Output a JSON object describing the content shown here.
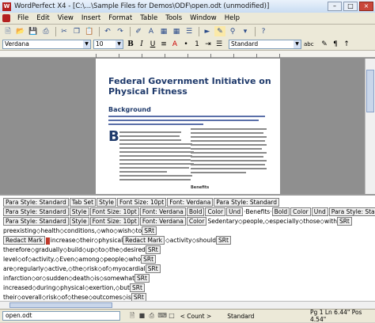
{
  "window": {
    "title": "WordPerfect X4 - [C:\\...\\Sample Files for Demos\\ODF\\open.odt (unmodified)]"
  },
  "menu": [
    "File",
    "Edit",
    "View",
    "Insert",
    "Format",
    "Table",
    "Tools",
    "Window",
    "Help"
  ],
  "format_bar": {
    "font": "Verdana",
    "size": "10",
    "style": "Standard"
  },
  "document": {
    "title": "Federal Government Initiative on Physical Fitness",
    "heading": "Background",
    "dropcap": "B",
    "subhead": "Benefits"
  },
  "reveal_codes": [
    [
      "Para Style: Standard",
      "Tab Set",
      "Style",
      "Font Size: 10pt",
      "Font: Verdana",
      "Para Style: Standard"
    ],
    [
      "Para Style: Standard",
      "Style",
      "Font Size: 10pt",
      "Font: Verdana",
      "Bold",
      "Color",
      "Und",
      "·Benefits·",
      "Bold",
      "Color",
      "Und",
      "Para Style: Standard"
    ],
    [
      "Para Style: Standard",
      "Style",
      "Font Size: 10pt",
      "Font: Verdana",
      "Color",
      "Sedentary◇people,◇especially◇those◇with",
      "SRt"
    ],
    [
      "preexisting◇health◇conditions,◇who◇wish◇to",
      "SRt"
    ],
    [
      "Redact Mark",
      "increase◇their◇physical",
      "Redact Mark",
      "◇activity◇should",
      "SRt"
    ],
    [
      "therefore◇gradually◇build◇up◇to◇the◇desired",
      "SRt"
    ],
    [
      "level◇of◇activity.◇Even◇among◇people◇who",
      "SRt"
    ],
    [
      "are◇regularly◇active,◇the◇risk◇of◇myocardial",
      "SRt"
    ],
    [
      "infarction◇or◇sudden◇death◇is◇somewhat",
      "SRt"
    ],
    [
      "increased◇during◇physical◇exertion,◇but",
      "SRt"
    ],
    [
      "their◇overall◇risk◇of◇these◇outcomes◇is",
      "SRt"
    ]
  ],
  "status": {
    "doc_tab": "open.odt",
    "count": "< Count >",
    "style": "Standard",
    "position": "Pg 1 Ln 6.44\" Pos 4.54\""
  }
}
